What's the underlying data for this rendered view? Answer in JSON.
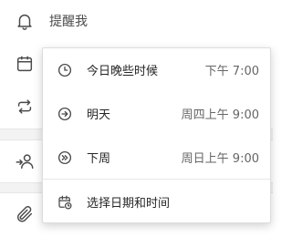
{
  "reminder": {
    "label": "提醒我",
    "icon": "bell-icon"
  },
  "side_icons": {
    "due": "calendar-icon",
    "repeat": "repeat-icon",
    "assign": "assign-user-icon",
    "attach": "paperclip-icon"
  },
  "menu": {
    "items": [
      {
        "label": "今日晚些时候",
        "time": "下午 7:00",
        "icon": "clock-icon"
      },
      {
        "label": "明天",
        "time": "周四上午 9:00",
        "icon": "arrow-right-circle-icon"
      },
      {
        "label": "下周",
        "time": "周日上午 9:00",
        "icon": "double-arrow-circle-icon"
      },
      {
        "label": "选择日期和时间",
        "time": "",
        "icon": "calendar-clock-icon"
      }
    ]
  },
  "colors": {
    "icon": "#4a4a4a",
    "text": "#262626",
    "muted": "#666666",
    "separator": "#e6e6e6"
  }
}
